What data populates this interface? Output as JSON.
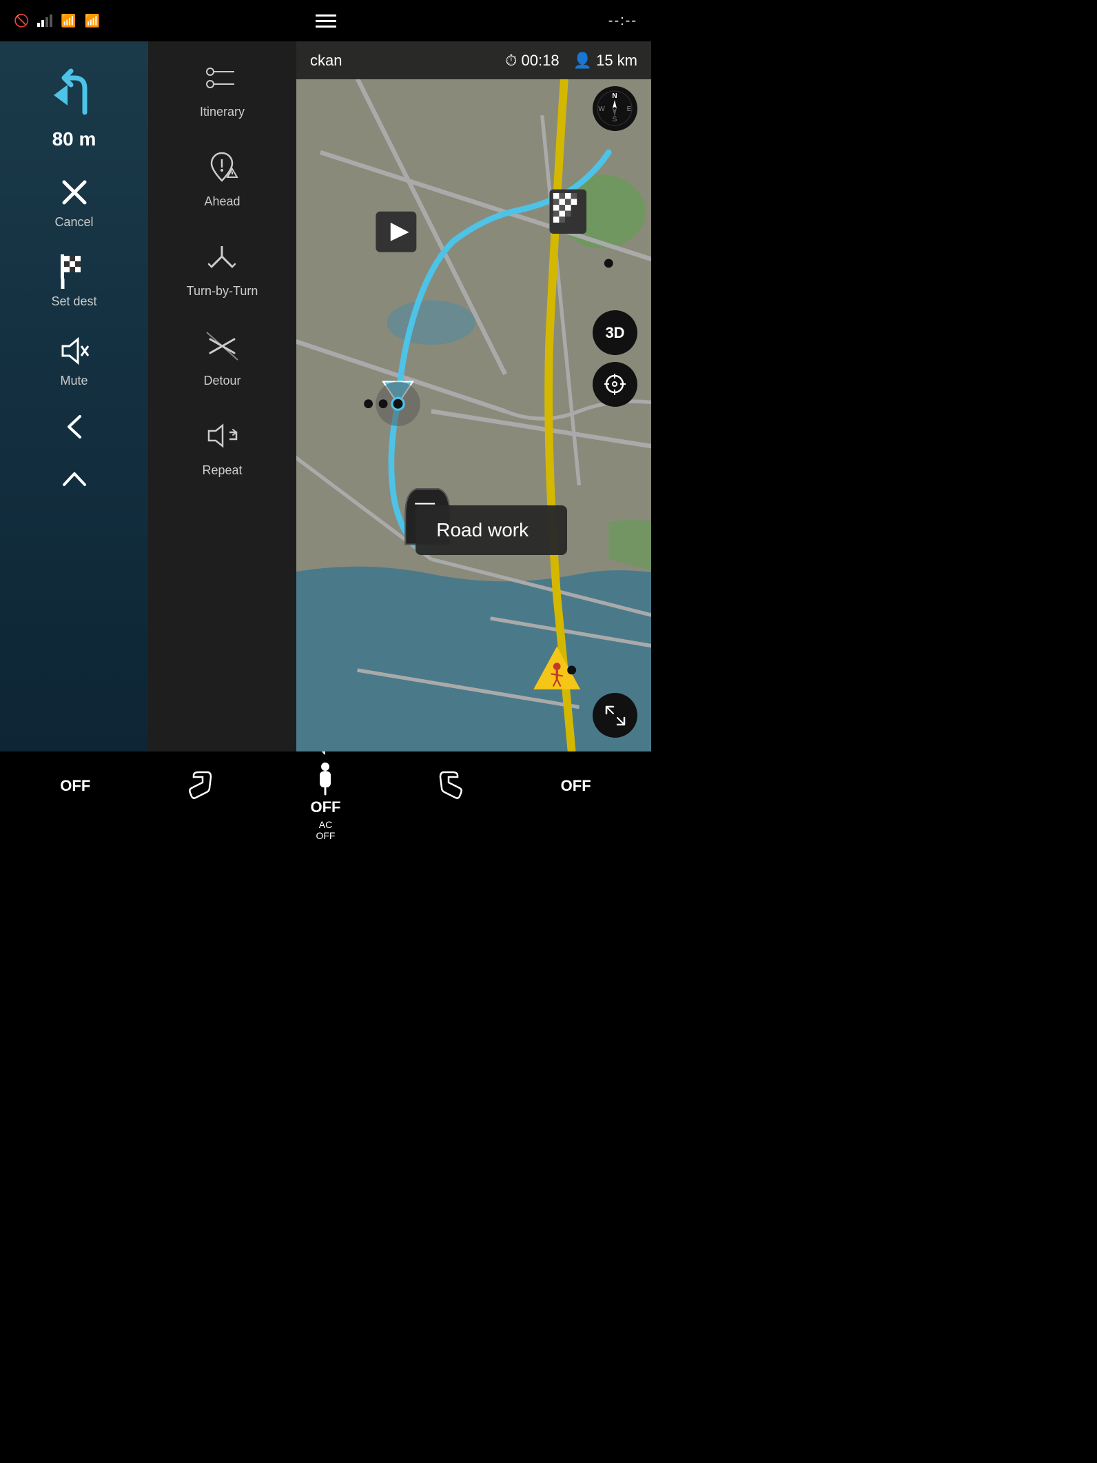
{
  "statusBar": {
    "timeDisplay": "--:--",
    "hamburgerLabel": "menu"
  },
  "leftSidebar": {
    "distance": "80 m",
    "cancelLabel": "Cancel",
    "setDestLabel": "Set dest",
    "muteLabel": "Mute",
    "backLabel": "back",
    "upLabel": "up"
  },
  "middleSidebar": {
    "itineraryLabel": "Itinerary",
    "aheadLabel": "Ahead",
    "turnByTurnLabel": "Turn-by-Turn",
    "detourLabel": "Detour",
    "repeatLabel": "Repeat"
  },
  "mapNav": {
    "destination": "ckan",
    "time": "00:18",
    "distance": "15 km",
    "timeIcon": "⏱",
    "distIcon": "👤"
  },
  "mapControls": {
    "btn3d": "3D",
    "btnTarget": "⊕",
    "btnResize": "⤡",
    "compassN": "N",
    "compassS": "S",
    "compassE": "E",
    "compassW": "W"
  },
  "roadwork": {
    "tooltip": "Road work"
  },
  "bottomBar": {
    "leftOff": "OFF",
    "seatLeft": "seat",
    "fanIcon": "fan",
    "acOff": "AC\nOFF",
    "seatRight": "seat",
    "rightOff": "OFF",
    "mainLabel": "OFF"
  }
}
